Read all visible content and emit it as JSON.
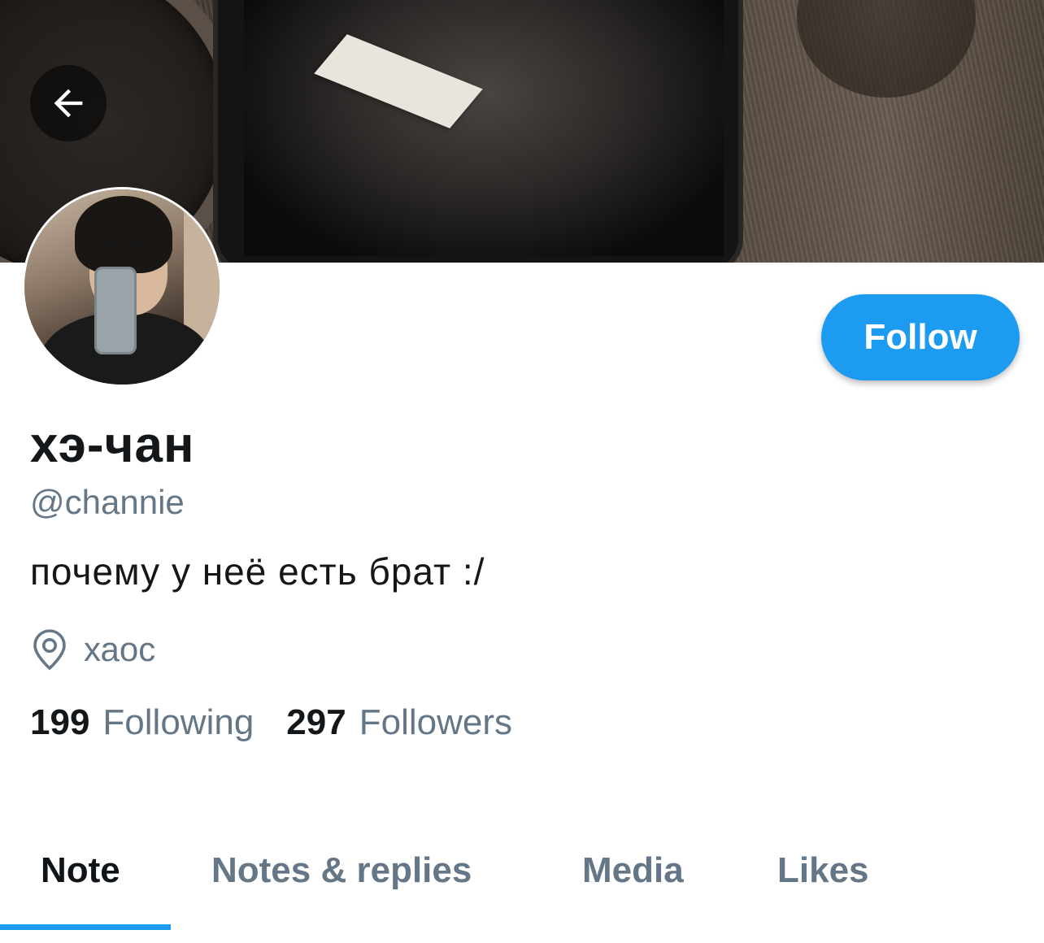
{
  "header": {
    "back_icon": "arrow-left-icon"
  },
  "profile": {
    "display_name": "хэ-чан",
    "handle": "@channie",
    "bio": "почему у неё есть брат :/",
    "location": "хаос",
    "location_icon": "location-pin-icon",
    "follow_label": "Follow",
    "following_count": "199",
    "following_label": "Following",
    "followers_count": "297",
    "followers_label": "Followers"
  },
  "tabs": [
    {
      "label": "Note",
      "active": true
    },
    {
      "label": "Notes & replies",
      "active": false
    },
    {
      "label": "Media",
      "active": false
    },
    {
      "label": "Likes",
      "active": false
    }
  ],
  "colors": {
    "accent": "#1d9bf0",
    "secondary_text": "#657786",
    "primary_text": "#14171a"
  }
}
